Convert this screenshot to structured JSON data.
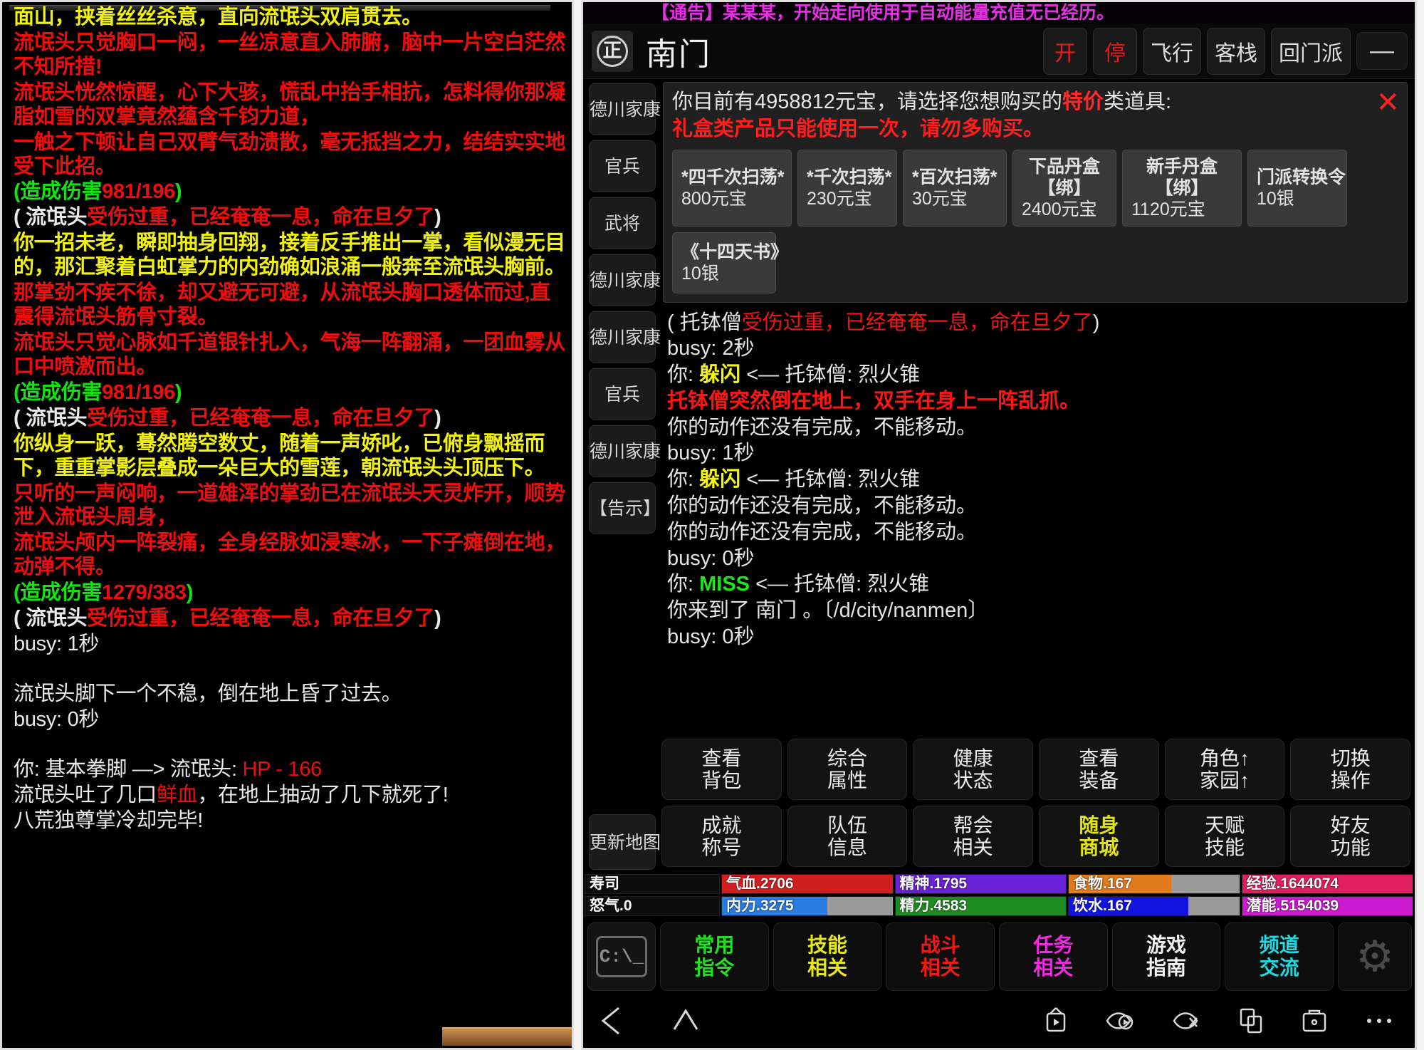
{
  "left_log": {
    "lines": [
      {
        "text": "面山，挟着丝丝杀意，直向流氓头双肩贯去。",
        "color": "yellow",
        "clipped": true
      },
      {
        "text": "流氓头只觉胸口一闷，一丝凉意直入肺腑，脑中一片空白茫然不知所措!",
        "color": "red"
      },
      {
        "text": "流氓头恍然惊醒，心下大骇，慌乱中抬手相抗，怎料得你那凝脂如雪的双掌竟然蕴含千钧力道，",
        "color": "red"
      },
      {
        "text": "一触之下顿让自己双臂气劲溃散，毫无抵挡之力，结结实实地受下此招。",
        "color": "red"
      },
      {
        "text": "(造成伤害981/196)",
        "color": "green",
        "inner_red": "981/196"
      },
      {
        "text": "( 流氓头受伤过重，已经奄奄一息，命在旦夕了)",
        "color": "white",
        "inner_red": "受伤过重，已经奄奄一息，命在旦夕了"
      },
      {
        "text": "你一招未老，瞬即抽身回翔，接着反手推出一掌，看似漫无目的，那汇聚着白虹掌力的内劲确如浪涌一般奔至流氓头胸前。",
        "color": "yellow"
      },
      {
        "text": "那掌劲不疾不徐，却又避无可避，从流氓头胸口透体而过,直震得流氓头筋骨寸裂。",
        "color": "red"
      },
      {
        "text": "流氓头只觉心脉如千道银针扎入，气海一阵翻涌，一团血雾从口中喷激而出。",
        "color": "red"
      },
      {
        "text": "(造成伤害981/196)",
        "color": "green",
        "inner_red": "981/196"
      },
      {
        "text": "( 流氓头受伤过重，已经奄奄一息，命在旦夕了)",
        "color": "white",
        "inner_red": "受伤过重，已经奄奄一息，命在旦夕了"
      },
      {
        "text": "你纵身一跃，蓦然腾空数丈，随着一声娇叱，已俯身飘摇而下，重重掌影层叠成一朵巨大的雪莲，朝流氓头头顶压下。",
        "color": "yellow"
      },
      {
        "text": "只听的一声闷响，一道雄浑的掌劲已在流氓头天灵炸开，顺势泄入流氓头周身，",
        "color": "red"
      },
      {
        "text": "流氓头颅内一阵裂痛，全身经脉如浸寒冰，一下子瘫倒在地，动弹不得。",
        "color": "red"
      },
      {
        "text": "(造成伤害1279/383)",
        "color": "green",
        "inner_red": "1279/383"
      },
      {
        "text": "( 流氓头受伤过重，已经奄奄一息，命在旦夕了)",
        "color": "white",
        "inner_red": "受伤过重，已经奄奄一息，命在旦夕了"
      },
      {
        "text": "busy: 1秒",
        "color": "white",
        "thin": true
      },
      {
        "text": "",
        "color": "white",
        "spacer": true
      },
      {
        "text": "流氓头脚下一个不稳，倒在地上昏了过去。",
        "color": "white",
        "thin": true
      },
      {
        "text": "busy: 0秒",
        "color": "white",
        "thin": true
      },
      {
        "text": "",
        "color": "white",
        "spacer": true
      },
      {
        "text": "你: 基本拳脚 —> 流氓头: HP - 166",
        "color": "white",
        "thin": true,
        "inner_red": "HP - 166"
      },
      {
        "text": "流氓头吐了几口鲜血，在地上抽动了几下就死了!",
        "color": "white",
        "thin": true,
        "inner_red": "鲜血"
      },
      {
        "text": "八荒独尊掌冷却完毕!",
        "color": "white",
        "thin": true
      }
    ]
  },
  "right_panel": {
    "marquee": "【通告】某某某，开始走向使用于自动能量充值无已经历。",
    "header": {
      "sect_icon_char": "正",
      "location_title": "南门",
      "buttons": [
        {
          "label": "开",
          "style": "red"
        },
        {
          "label": "停",
          "style": "red"
        },
        {
          "label": "飞行",
          "style": "normal"
        },
        {
          "label": "客栈",
          "style": "normal"
        },
        {
          "label": "回门派",
          "style": "normal"
        }
      ],
      "minimize_label": "—"
    },
    "side_tabs": [
      "德川家康",
      "官兵",
      "武将",
      "德川家康",
      "德川家康",
      "官兵",
      "德川家康",
      "【告示】"
    ],
    "map_button": "更新地图",
    "shop": {
      "title_prefix": "你目前有",
      "gold_amount": "4958812",
      "title_mid": "元宝，请选择您想购买的",
      "highlight": "特价",
      "title_suffix": "类道具:",
      "full_title": "你目前有4958812元宝，请选择您想购买的特价类道具:",
      "warning": "礼盒类产品只能使用一次，请勿多购买。",
      "close_label": "✕",
      "items": [
        {
          "name": "*四千次扫荡*",
          "sub": "",
          "price": "800元宝"
        },
        {
          "name": "*千次扫荡*",
          "sub": "",
          "price": "230元宝"
        },
        {
          "name": "*百次扫荡*",
          "sub": "",
          "price": "30元宝"
        },
        {
          "name": "下品丹盒",
          "sub": "【绑】",
          "price": "2400元宝"
        },
        {
          "name": "新手丹盒",
          "sub": "【绑】",
          "price": "1120元宝"
        },
        {
          "name": "门派转换令",
          "sub": "",
          "price": "10银"
        },
        {
          "name": "《十四天书》",
          "sub": "",
          "price": "10银"
        }
      ]
    },
    "chat_lines": [
      {
        "parts": [
          {
            "t": "( 托钵僧",
            "c": "white"
          },
          {
            "t": "受伤过重，已经奄奄一息，命在旦夕了",
            "c": "red"
          },
          {
            "t": ")",
            "c": "white"
          }
        ]
      },
      {
        "parts": [
          {
            "t": "busy: 2秒",
            "c": "white"
          }
        ]
      },
      {
        "parts": [
          {
            "t": "你: ",
            "c": "white"
          },
          {
            "t": "躲闪",
            "c": "yellow"
          },
          {
            "t": " <— 托钵僧: 烈火锥",
            "c": "white"
          }
        ]
      },
      {
        "parts": [
          {
            "t": "托钵僧突然倒在地上，双手在身上一阵乱抓。",
            "c": "redbold"
          }
        ]
      },
      {
        "parts": [
          {
            "t": "你的动作还没有完成，不能移动。",
            "c": "white"
          }
        ]
      },
      {
        "parts": [
          {
            "t": "busy: 1秒",
            "c": "white"
          }
        ]
      },
      {
        "parts": [
          {
            "t": "你: ",
            "c": "white"
          },
          {
            "t": "躲闪",
            "c": "yellow"
          },
          {
            "t": " <— 托钵僧: 烈火锥",
            "c": "white"
          }
        ]
      },
      {
        "parts": [
          {
            "t": "你的动作还没有完成，不能移动。",
            "c": "white"
          }
        ]
      },
      {
        "parts": [
          {
            "t": "你的动作还没有完成，不能移动。",
            "c": "white"
          }
        ]
      },
      {
        "parts": [
          {
            "t": "busy: 0秒",
            "c": "white"
          }
        ]
      },
      {
        "parts": [
          {
            "t": "你: ",
            "c": "white"
          },
          {
            "t": "MISS",
            "c": "green"
          },
          {
            "t": " <— 托钵僧: 烈火锥",
            "c": "white"
          }
        ]
      },
      {
        "parts": [
          {
            "t": "你来到了 南门 。〔/d/city/nanmen〕",
            "c": "white"
          }
        ]
      },
      {
        "parts": [
          {
            "t": "busy: 0秒",
            "c": "white"
          }
        ]
      }
    ],
    "actions": {
      "row1": [
        {
          "l1": "查看",
          "l2": "背包",
          "style": "normal"
        },
        {
          "l1": "综合",
          "l2": "属性",
          "style": "normal"
        },
        {
          "l1": "健康",
          "l2": "状态",
          "style": "normal"
        },
        {
          "l1": "查看",
          "l2": "装备",
          "style": "normal"
        },
        {
          "l1": "角色↑",
          "l2": "家园↑",
          "style": "normal"
        },
        {
          "l1": "切换",
          "l2": "操作",
          "style": "normal"
        }
      ],
      "row2": [
        {
          "l1": "成就",
          "l2": "称号",
          "style": "normal"
        },
        {
          "l1": "队伍",
          "l2": "信息",
          "style": "normal"
        },
        {
          "l1": "帮会",
          "l2": "相关",
          "style": "normal"
        },
        {
          "l1": "随身",
          "l2": "商城",
          "style": "gold"
        },
        {
          "l1": "天赋",
          "l2": "技能",
          "style": "normal"
        },
        {
          "l1": "好友",
          "l2": "功能",
          "style": "normal"
        }
      ]
    },
    "stats": {
      "row1": [
        {
          "label": "寿司",
          "value": "",
          "color": "#000000",
          "pct": 0,
          "name": true
        },
        {
          "label": "气血.2706",
          "value": "2706",
          "color": "#d02020",
          "pct": 100
        },
        {
          "label": "精神.1795",
          "value": "1795",
          "color": "#6822d8",
          "pct": 100
        },
        {
          "label": "食物.167",
          "value": "167",
          "color": "#e07a1a",
          "pct": 60
        },
        {
          "label": "经验.1644074",
          "value": "1644074",
          "color": "#e02060",
          "pct": 100
        }
      ],
      "row2": [
        {
          "label": "怒气.0",
          "value": "0",
          "color": "#000000",
          "pct": 0,
          "name": true
        },
        {
          "label": "内力.3275",
          "value": "3275",
          "color": "#2a7ce0",
          "pct": 62
        },
        {
          "label": "精力.4583",
          "value": "4583",
          "color": "#1e8c24",
          "pct": 100
        },
        {
          "label": "饮水.167",
          "value": "167",
          "color": "#1414e0",
          "pct": 70
        },
        {
          "label": "潜能.5154039",
          "value": "5154039",
          "color": "#cc1ad0",
          "pct": 100
        }
      ]
    },
    "cmdbar": {
      "console_glyph": "C:\\_",
      "tabs": [
        {
          "l1": "常用",
          "l2": "指令",
          "color": "#22e022"
        },
        {
          "l1": "技能",
          "l2": "相关",
          "color": "#e8e818"
        },
        {
          "l1": "战斗",
          "l2": "相关",
          "color": "#f01818"
        },
        {
          "l1": "任务",
          "l2": "相关",
          "color": "#ef2ae0"
        },
        {
          "l1": "游戏",
          "l2": "指南",
          "color": "#f0f0f0"
        },
        {
          "l1": "频道",
          "l2": "交流",
          "color": "#22d8e0"
        }
      ],
      "gear_icon": "gear-icon"
    },
    "navbar": {
      "back_icon": "back-triangle-icon",
      "home_icon": "home-chevron-icon",
      "right_icons": [
        "tv-play-icon",
        "eye-play-icon",
        "eye-close-icon",
        "copy-icon",
        "briefcase-icon",
        "more-dots-icon"
      ]
    }
  }
}
